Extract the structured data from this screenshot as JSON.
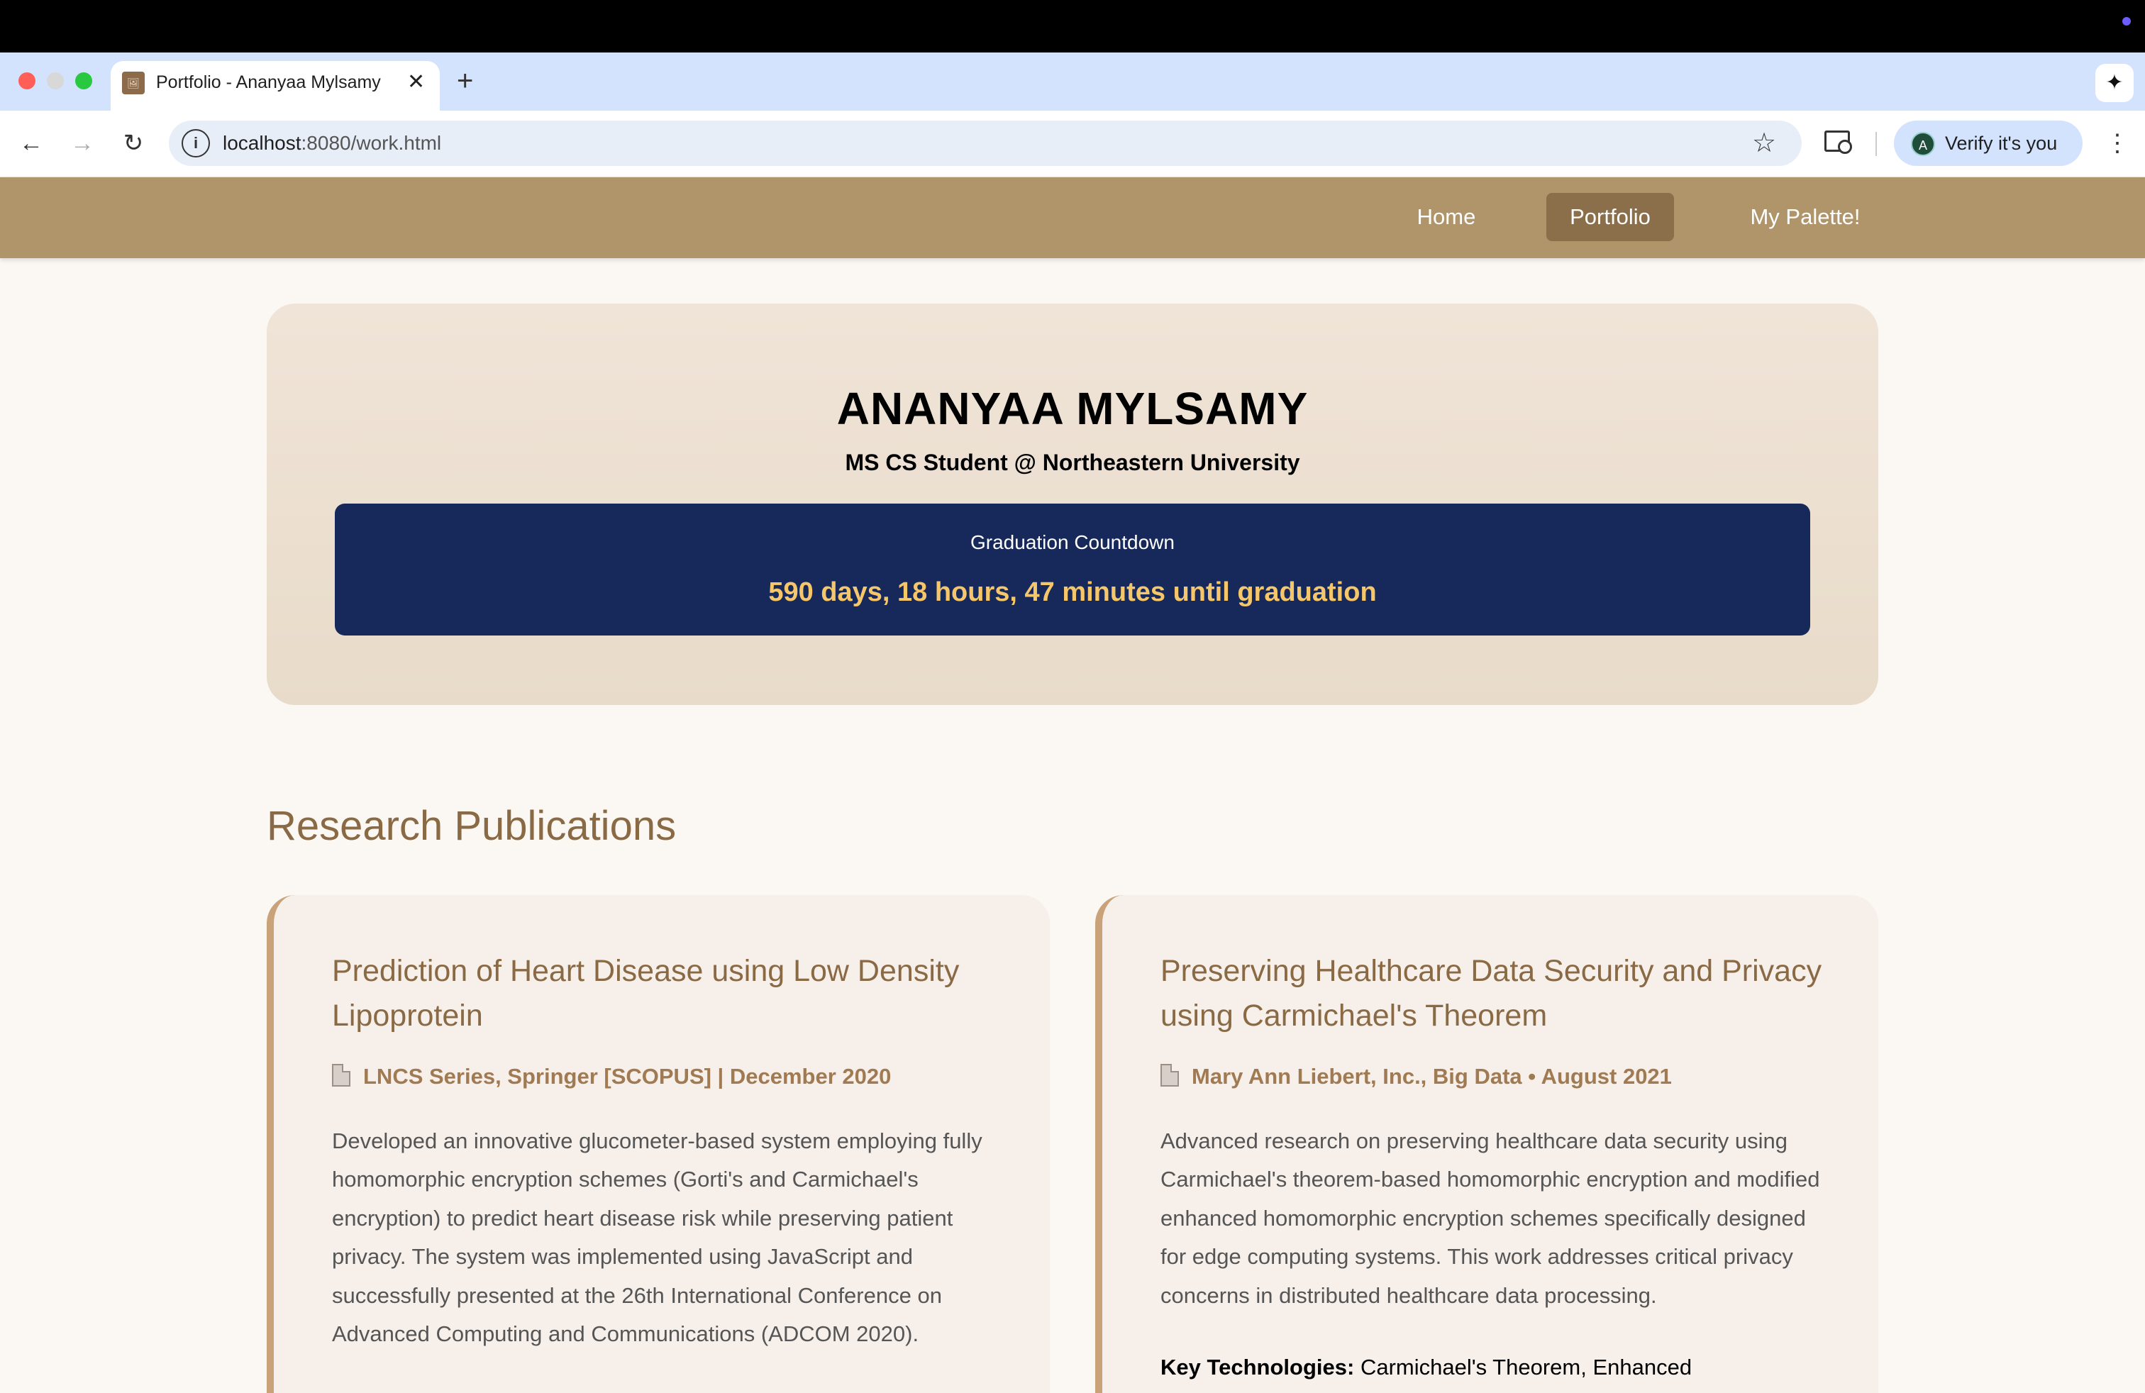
{
  "browser": {
    "tab_title": "Portfolio - Ananyaa Mylsamy",
    "tab_close": "✕",
    "new_tab": "+",
    "url_host": "localhost",
    "url_rest": ":8080/work.html",
    "verify_label": "Verify it's you",
    "avatar_letter": "A"
  },
  "nav": {
    "items": [
      {
        "label": "Home"
      },
      {
        "label": "Portfolio",
        "active": true
      },
      {
        "label": "My Palette!"
      }
    ]
  },
  "hero": {
    "name": "ANANYAA MYLSAMY",
    "subtitle": "MS CS Student @ Northeastern University",
    "countdown_label": "Graduation Countdown",
    "countdown_value": "590 days, 18 hours, 47 minutes until graduation"
  },
  "publications": {
    "section_title": "Research Publications",
    "items": [
      {
        "title": "Prediction of Heart Disease using Low Density Lipoprotein",
        "meta": "LNCS Series, Springer [SCOPUS] | December 2020",
        "description": "Developed an innovative glucometer-based system employing fully homomorphic encryption schemes (Gorti's and Carmichael's encryption) to predict heart disease risk while preserving patient privacy. The system was implemented using JavaScript and successfully presented at the 26th International Conference on Advanced Computing and Communications (ADCOM 2020)."
      },
      {
        "title": "Preserving Healthcare Data Security and Privacy using Carmichael's Theorem",
        "meta": "Mary Ann Liebert, Inc., Big Data • August 2021",
        "description": "Advanced research on preserving healthcare data security using Carmichael's theorem-based homomorphic encryption and modified enhanced homomorphic encryption schemes specifically designed for edge computing systems. This work addresses critical privacy concerns in distributed healthcare data processing.",
        "key_tech_label": "Key Technologies:",
        "key_tech_value": "Carmichael's Theorem, Enhanced"
      }
    ]
  },
  "colors": {
    "nav_bg": "#b0956a",
    "nav_active": "#8a6f4a",
    "countdown_bg": "#16295a",
    "countdown_text": "#f5c76a",
    "accent_brown": "#8a6a44",
    "card_border": "#c9a27a"
  }
}
